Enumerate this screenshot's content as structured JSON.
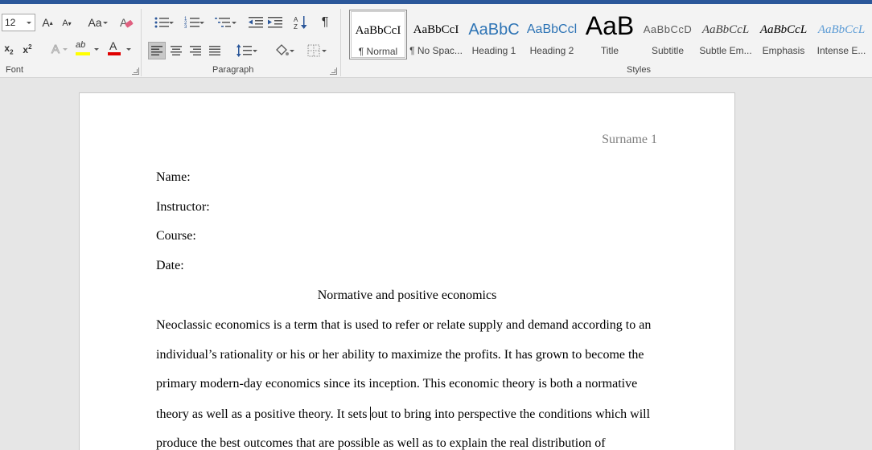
{
  "font_group": {
    "label": "Font",
    "font_size": "12",
    "grow_label": "A",
    "shrink_label": "A",
    "change_case_label": "Aa",
    "subscript_label": "x",
    "superscript_label": "x",
    "text_effects_label": "A",
    "highlight_label": "ab",
    "highlight_color": "#ffff00",
    "font_color_label": "A",
    "font_color": "#e00000"
  },
  "paragraph_group": {
    "label": "Paragraph",
    "pilcrow": "¶"
  },
  "styles_group": {
    "label": "Styles",
    "items": [
      {
        "preview": "AaBbCcI",
        "name": "¶ Normal",
        "color": "#000000"
      },
      {
        "preview": "AaBbCcI",
        "name": "¶ No Spac...",
        "color": "#000000"
      },
      {
        "preview": "AaBbC",
        "name": "Heading 1",
        "color": "#2e74b5"
      },
      {
        "preview": "AaBbCcl",
        "name": "Heading 2",
        "color": "#2e74b5"
      },
      {
        "preview": "AaB",
        "name": "Title",
        "color": "#000000"
      },
      {
        "preview": "AaBbCcD",
        "name": "Subtitle",
        "color": "#5a5a5a"
      },
      {
        "preview": "AaBbCcL",
        "name": "Subtle Em...",
        "color": "#404040"
      },
      {
        "preview": "AaBbCcL",
        "name": "Emphasis",
        "color": "#000000"
      },
      {
        "preview": "AaBbCcL",
        "name": "Intense E...",
        "color": "#5b9bd5"
      }
    ]
  },
  "document": {
    "header": "Surname 1",
    "fields": [
      "Name:",
      "Instructor:",
      "Course:",
      "Date:"
    ],
    "title": "Normative and positive economics",
    "body_lines": [
      "Neoclassic economics is a term that is used to refer or relate supply and demand according to an",
      "individual’s rationality or his or her ability to maximize the profits. It has grown to become the",
      "primary modern-day economics since its inception. This economic theory is both a normative",
      "theory as well as a positive theory. It sets ",
      "produce the best outcomes that are possible as well as to explain the real distribution of"
    ],
    "body_line4_after_cursor": "out to bring into perspective the conditions which will"
  }
}
